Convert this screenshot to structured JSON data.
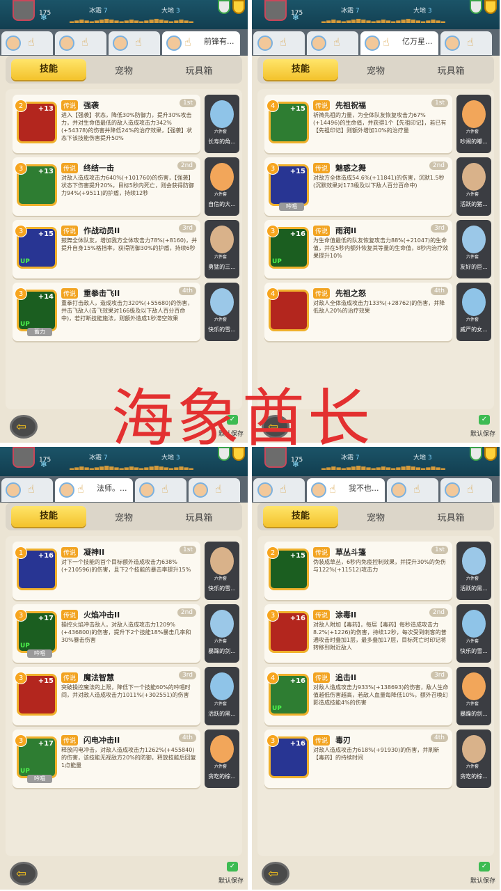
{
  "watermark": "海象酋长",
  "common": {
    "tabs": [
      "技能",
      "宠物",
      "玩具箱"
    ],
    "legend_badge": "传说",
    "pet_label": "六件套",
    "save_label": "默认保存",
    "top_level": "175",
    "zone_left": "冰霜",
    "zone_left_lvl": "7",
    "zone_right": "大地",
    "zone_right_lvl": "3"
  },
  "panels": [
    {
      "hero_name": "前锋有...",
      "cards": [
        {
          "num": "2",
          "plus": "+13",
          "up": "",
          "tag": "",
          "name": "强袭",
          "rank": "1st",
          "desc": "进入【强袭】状态，降低30%防御力，提升30%攻击力，并对生命值最低的敌人造成攻击力342%(+54378)的伤害并降低24%的治疗效果，【强袭】状态下该技能伤害提升50%",
          "pet": "长寿的角..."
        },
        {
          "num": "3",
          "plus": "+13",
          "up": "",
          "tag": "",
          "name": "终结一击",
          "rank": "2nd",
          "desc": "对敌人造成攻击力640%(+101760)的伤害，【强袭】状态下伤害提升20%，目标5秒内死亡，则会获得防御力94%(+9511)的护盾，持续12秒",
          "pet": "自信的大..."
        },
        {
          "num": "3",
          "plus": "+15",
          "up": "UP",
          "tag": "",
          "name": "作战动员II",
          "rank": "3rd",
          "desc": "鼓舞全体队友，增加我方全体攻击力78%(+8160)，并提升自身15%格挡率，获得防御30%的护盾，持续6秒",
          "pet": "勇猛的三..."
        },
        {
          "num": "3",
          "plus": "+14",
          "up": "UP",
          "tag": "蓄力",
          "name": "重拳击飞II",
          "rank": "4th",
          "desc": "重拳打击敌人，造成攻击力320%(+55680)的伤害，并击飞敌人(击飞效果对166级及以下敌人百分百命中)，若打断技能施法，则额外造成1秒滞空效果",
          "pet": "快乐的雪..."
        }
      ]
    },
    {
      "hero_name": "亿万星...",
      "cards": [
        {
          "num": "4",
          "plus": "+15",
          "up": "",
          "tag": "",
          "name": "先祖祝福",
          "rank": "1st",
          "desc": "祈祷先祖的力量，为全体队友恢复攻击力67%(+14496)的生命值，并获得1个【先祖印记】，若已有【先祖印记】则额外增加10%的治疗量",
          "pet": "吵闹的嘟..."
        },
        {
          "num": "3",
          "plus": "+15",
          "up": "",
          "tag": "吟唱",
          "name": "魅惑之舞",
          "rank": "2nd",
          "desc": "对敌方全体造成54.6%(+11841)的伤害，沉默1.5秒(沉默效果对173级及以下敌人百分百命中)",
          "pet": "活跃的猪..."
        },
        {
          "num": "3",
          "plus": "+16",
          "up": "UP",
          "tag": "",
          "name": "雨润II",
          "rank": "3rd",
          "desc": "为生命值最低的队友恢复攻击力88%(+21047)的生命值，并在5秒内额外恢复其等量的生命值，8秒内治疗效果提升10%",
          "pet": "友好的巨..."
        },
        {
          "num": "4",
          "plus": "",
          "up": "",
          "tag": "",
          "name": "先祖之怒",
          "rank": "4th",
          "desc": "对敌人全体造成攻击力133%(+28762)的伤害，并降低敌人20%的治疗效果",
          "pet": "威严的女..."
        }
      ]
    },
    {
      "hero_name": "法师。...",
      "cards": [
        {
          "num": "1",
          "plus": "+16",
          "up": "",
          "tag": "",
          "name": "凝神II",
          "rank": "1st",
          "desc": "对下一个技能的首个目标额外造成攻击力638%(+210596)的伤害，且下2个技能的暴击率提升15%",
          "pet": "快乐的雪..."
        },
        {
          "num": "3",
          "plus": "+17",
          "up": "UP",
          "tag": "吟唱",
          "name": "火焰冲击II",
          "rank": "2nd",
          "desc": "操控火焰冲击敌人，对敌人造成攻击力1209%(+436800)的伤害，提升下2个技能18%暴击几率和30%暴击伤害",
          "pet": "暴躁的剑..."
        },
        {
          "num": "3",
          "plus": "+15",
          "up": "",
          "tag": "",
          "name": "魔法智慧",
          "rank": "3rd",
          "desc": "突破操控魔法的上限，降低下一个技能60%的吟唱时间，并对敌人造成攻击力1011%(+302551)的伤害",
          "pet": "活跃的黑..."
        },
        {
          "num": "3",
          "plus": "+17",
          "up": "UP",
          "tag": "吟唱",
          "name": "闪电冲击II",
          "rank": "4th",
          "desc": "释放闪电冲击，对敌人造成攻击力1262%(+455840)的伤害，该技能无视敌方20%的防御，释放技能后回复1点能量",
          "pet": "贪吃的棕..."
        }
      ]
    },
    {
      "hero_name": "我不也...",
      "cards": [
        {
          "num": "2",
          "plus": "+15",
          "up": "",
          "tag": "",
          "name": "草丛斗篷",
          "rank": "1st",
          "desc": "伪装成草丛，6秒内免疫控制效果，并提升30%的免伤与122%(+11512)攻击力",
          "pet": "活跃的黑..."
        },
        {
          "num": "3",
          "plus": "+16",
          "up": "",
          "tag": "",
          "name": "涂毒II",
          "rank": "2nd",
          "desc": "对敌人附加【毒药】，每层【毒药】每秒造成攻击力8.2%(+1226)的伤害，持续12秒，每次受到刺客的普通攻击时叠加1层，最多叠加17层，目标死亡时印记将转移到附近敌人",
          "pet": "快乐的雪..."
        },
        {
          "num": "4",
          "plus": "+16",
          "up": "UP",
          "tag": "",
          "name": "追击II",
          "rank": "3rd",
          "desc": "对敌人造成攻击力933%(+138693)的伤害，敌人生命值越低伤害越高，若敌人血量每降低10%，额外召唤幻影造成技能4%的伤害",
          "pet": "暴躁的剑..."
        },
        {
          "num": "3",
          "plus": "+16",
          "up": "",
          "tag": "",
          "name": "毒刃",
          "rank": "4th",
          "desc": "对敌人造成攻击力618%(+91930)的伤害，并刷新【毒药】的持续时间",
          "pet": "贪吃的棕..."
        }
      ]
    }
  ],
  "colors": {
    "accent": "#f3c22c",
    "legend": "#f2a422",
    "topbar": "#1b5468"
  }
}
